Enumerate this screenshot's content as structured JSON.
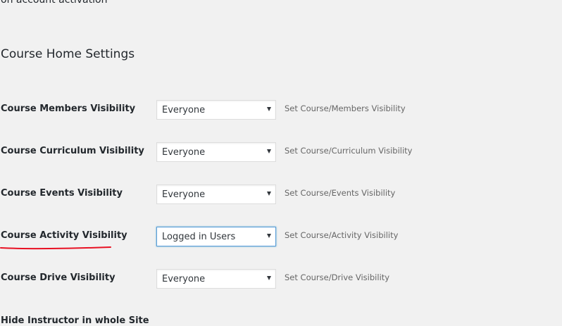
{
  "top_clipped_text": "on account activation",
  "section": {
    "title": "Course Home Settings"
  },
  "settings": [
    {
      "label": "Course Members Visibility",
      "value": "Everyone",
      "description": "Set Course/Members Visibility"
    },
    {
      "label": "Course Curriculum Visibility",
      "value": "Everyone",
      "description": "Set Course/Curriculum Visibility"
    },
    {
      "label": "Course Events Visibility",
      "value": "Everyone",
      "description": "Set Course/Events Visibility"
    },
    {
      "label": "Course Activity Visibility",
      "value": "Logged in Users",
      "description": "Set Course/Activity Visibility"
    },
    {
      "label": "Course Drive Visibility",
      "value": "Everyone",
      "description": "Set Course/Drive Visibility"
    }
  ],
  "bottom_clipped_text": "Hide Instructor in whole Site",
  "colors": {
    "background": "#f1f1f1",
    "annotation_red": "#e81123",
    "focus_blue": "#5b9dd9"
  },
  "icons": {
    "select_arrow": "triangle-down-icon"
  }
}
